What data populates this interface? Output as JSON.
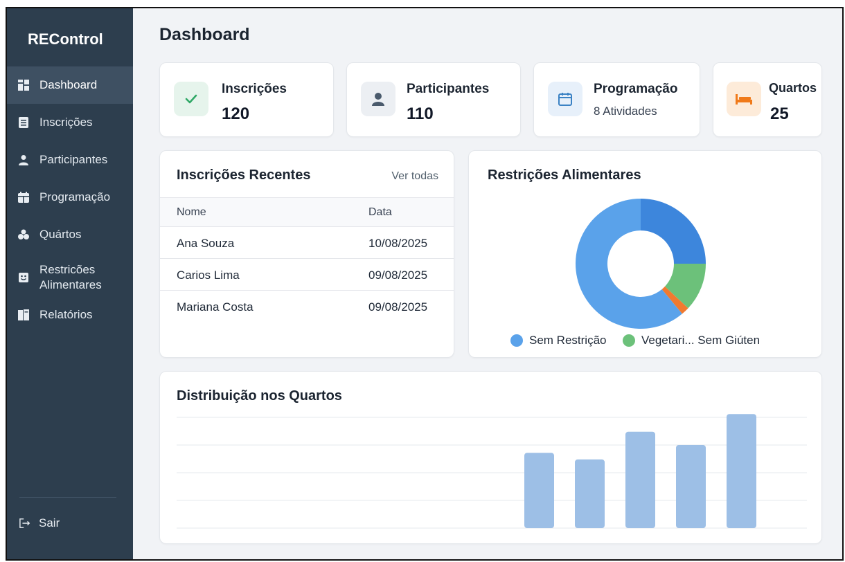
{
  "sidebar": {
    "brand": "REControl",
    "items": [
      {
        "label": "Dashboard",
        "icon": "grid-icon",
        "active": true
      },
      {
        "label": "Inscrições",
        "icon": "list-icon"
      },
      {
        "label": "Participantes",
        "icon": "user-icon"
      },
      {
        "label": "Programação",
        "icon": "calendar-icon"
      },
      {
        "label": "Quártos",
        "icon": "users-icon"
      },
      {
        "label": "Restricões Alimentares",
        "icon": "food-icon"
      },
      {
        "label": "Relatórios",
        "icon": "book-icon"
      }
    ],
    "logout": {
      "label": "Sair",
      "icon": "logout-icon"
    }
  },
  "header": {
    "title": "Dashboard"
  },
  "stats": [
    {
      "title": "Inscrições",
      "value": "120",
      "icon": "check-icon",
      "color": "#2fa866",
      "bg": "#e6f4ec"
    },
    {
      "title": "Participantes",
      "value": "110",
      "icon": "person-icon",
      "color": "#4a5a6c",
      "bg": "#eceff3"
    },
    {
      "title": "Programação",
      "subtitle": "8 Atividades",
      "icon": "calendar-icon",
      "color": "#3b82c4",
      "bg": "#e7f0fa"
    },
    {
      "title": "Quartos",
      "value": "25",
      "icon": "bed-icon",
      "color": "#f07a1a",
      "bg": "#fdebd9"
    }
  ],
  "recent": {
    "title": "Inscrições Recentes",
    "link": "Ver todas",
    "columns": [
      "Nome",
      "Data"
    ],
    "rows": [
      [
        "Ana Souza",
        "10/08/2025"
      ],
      [
        "Carios Lima",
        "09/08/2025"
      ],
      [
        "Mariana Costa",
        "09/08/2025"
      ]
    ]
  },
  "diet": {
    "title": "Restrições Alimentares",
    "legend": [
      {
        "label": "Sem Restrição",
        "color": "#5aa2ea"
      },
      {
        "label": "Vegetari... Sem Giúten",
        "color": "#6cc17a"
      }
    ]
  },
  "rooms": {
    "title": "Distribuição nos Quartos"
  },
  "chart_data": [
    {
      "type": "pie",
      "title": "Restrições Alimentares",
      "donut": true,
      "slices": [
        {
          "label": "",
          "value": 25,
          "color": "#3d86dc"
        },
        {
          "label": "",
          "value": 12,
          "color": "#6cc17a"
        },
        {
          "label": "",
          "value": 2,
          "color": "#f07a30"
        },
        {
          "label": "Sem Restrição",
          "value": 61,
          "color": "#5aa2ea"
        }
      ],
      "legend_position": "bottom"
    },
    {
      "type": "bar",
      "title": "Distribuição nos Quartos",
      "values": [
        68,
        62,
        87,
        75,
        103
      ],
      "ylim": [
        0,
        100
      ],
      "grid": true,
      "color": "#9dbfe6"
    }
  ]
}
